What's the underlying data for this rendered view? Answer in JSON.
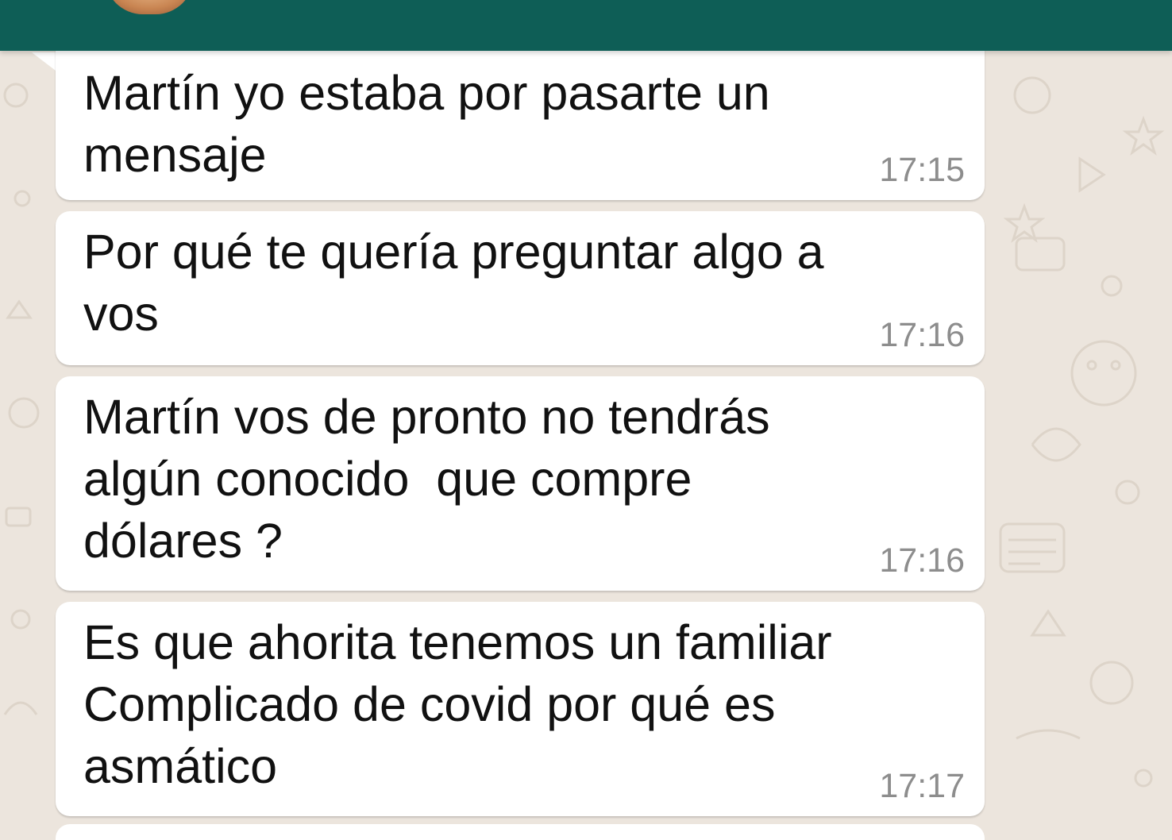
{
  "header": {
    "avatar_icon": "contact-avatar",
    "color": "#0E5E56"
  },
  "messages": [
    {
      "text": "Martín yo estaba por pasarte un\nmensaje",
      "time": "17:15"
    },
    {
      "text": "Por qué te quería preguntar algo a\nvos",
      "time": "17:16"
    },
    {
      "text": "Martín vos de pronto no tendrás\nalgún conocido  que compre\ndólares ?",
      "time": "17:16"
    },
    {
      "text": "Es que ahorita tenemos un familiar\nComplicado de covid por qué es\nasmático",
      "time": "17:17"
    }
  ],
  "colors": {
    "background": "#ECE5DD",
    "bubble": "#FFFFFF",
    "timestamp": "#8D8D8D"
  }
}
